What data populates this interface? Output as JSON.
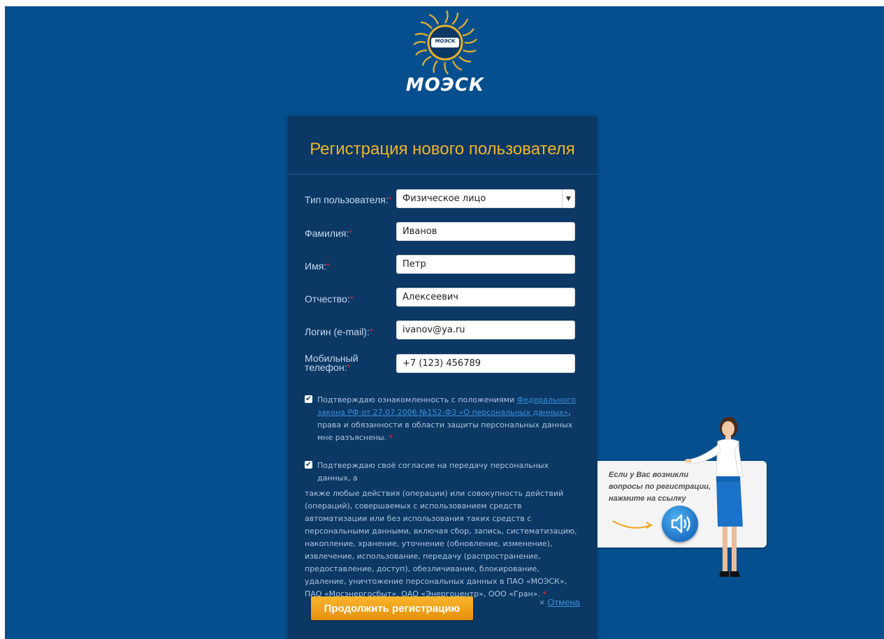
{
  "brand": {
    "logo_text": "МОЭСК",
    "emblem_text": "МОЭСК"
  },
  "form": {
    "title": "Регистрация нового пользователя",
    "fields": {
      "user_type": {
        "label": "Тип пользователя:",
        "value": "Физическое лицо"
      },
      "last_name": {
        "label": "Фамилия:",
        "value": "Иванов"
      },
      "first_name": {
        "label": "Имя:",
        "value": "Петр"
      },
      "patronymic": {
        "label": "Отчество:",
        "value": "Алексеевич"
      },
      "login": {
        "label": "Логин (e-mail):",
        "value": "ivanov@ya.ru"
      },
      "phone": {
        "label_line1": "Мобильный",
        "label_line2": "телефон:",
        "value": "+7 (123) 456789"
      }
    },
    "required_mark": "*",
    "consent1": {
      "checked": true,
      "text_before": "Подтверждаю ознакомленность с положениями ",
      "link_text": "Федерального закона РФ от 27.07.2006 №152-ФЗ «О персональных данных»",
      "text_after": ", права и обязанности в области защиты персональных данных мне разъяснены."
    },
    "consent2": {
      "checked": true,
      "line1": "Подтверждаю своё согласие на передачу персональных данных, а",
      "rest": "также любые действия (операции) или совокупность действий (операций), совершаемых с использованием средств автоматизации или без использования таких средств с персональными данными, включая сбор, запись, систематизацию, накопление, хранение, уточнение (обновление, изменение), извлечение, использование, передачу (распространение, предоставление, доступ), обезличивание, блокирование, удаление, уничтожение персональных данных в ПАО «МОЭСК», ПАО «Мосэнергосбыт», ОАО «Энергоцентр», ООО «Гран»."
    },
    "submit_label": "Продолжить регистрацию",
    "cancel_prefix": "×",
    "cancel_label": "Отмена"
  },
  "help": {
    "text": "Если у Вас возникли вопросы по регистрации, нажмите на ссылку"
  },
  "colors": {
    "page_background": "#064f8f",
    "panel_background": "#0b3864",
    "title": "#f1b427",
    "button": "#f5a419",
    "link": "#3a8fdc",
    "required": "#e3262e"
  }
}
